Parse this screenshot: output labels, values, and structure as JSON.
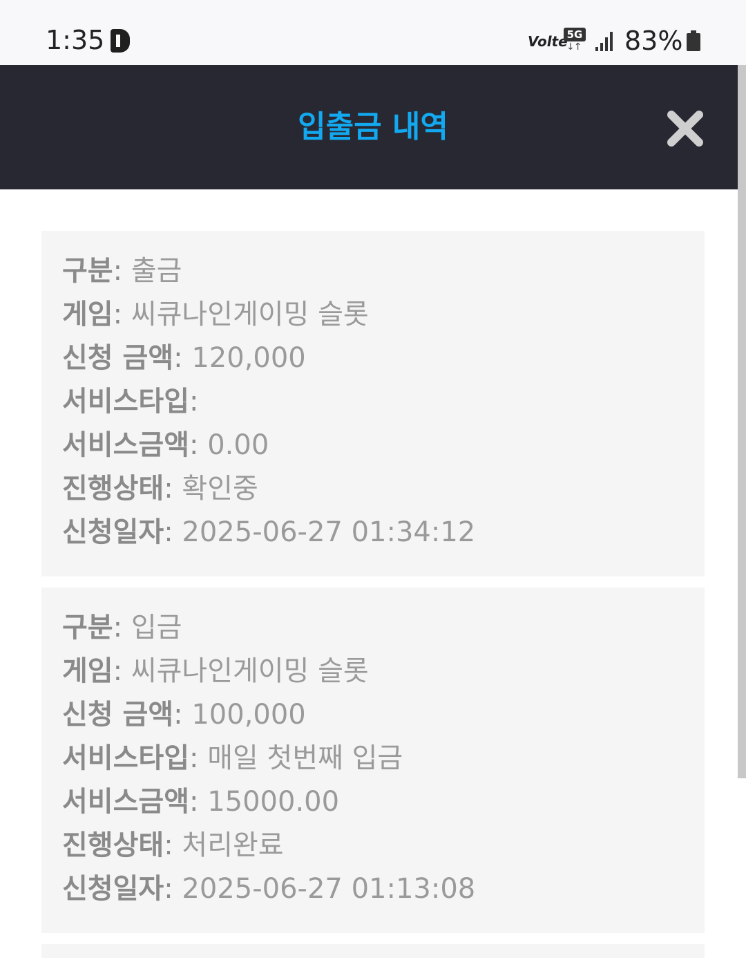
{
  "status_bar": {
    "time": "1:35",
    "volte": "Volte",
    "network": "5G",
    "battery": "83%"
  },
  "header": {
    "title": "입출금 내역",
    "close_icon": "close-icon"
  },
  "records": [
    {
      "fields": [
        {
          "label": "구분",
          "value": "출금"
        },
        {
          "label": "게임",
          "value": "씨큐나인게이밍 슬롯"
        },
        {
          "label": "신청 금액",
          "value": "120,000"
        },
        {
          "label": "서비스타입",
          "value": ""
        },
        {
          "label": "서비스금액",
          "value": "0.00"
        },
        {
          "label": "진행상태",
          "value": "확인중"
        },
        {
          "label": "신청일자",
          "value": "2025-06-27 01:34:12"
        }
      ]
    },
    {
      "fields": [
        {
          "label": "구분",
          "value": "입금"
        },
        {
          "label": "게임",
          "value": "씨큐나인게이밍 슬롯"
        },
        {
          "label": "신청 금액",
          "value": "100,000"
        },
        {
          "label": "서비스타입",
          "value": "매일 첫번째 입금"
        },
        {
          "label": "서비스금액",
          "value": "15000.00"
        },
        {
          "label": "진행상태",
          "value": "처리완료"
        },
        {
          "label": "신청일자",
          "value": "2025-06-27 01:13:08"
        }
      ]
    }
  ]
}
